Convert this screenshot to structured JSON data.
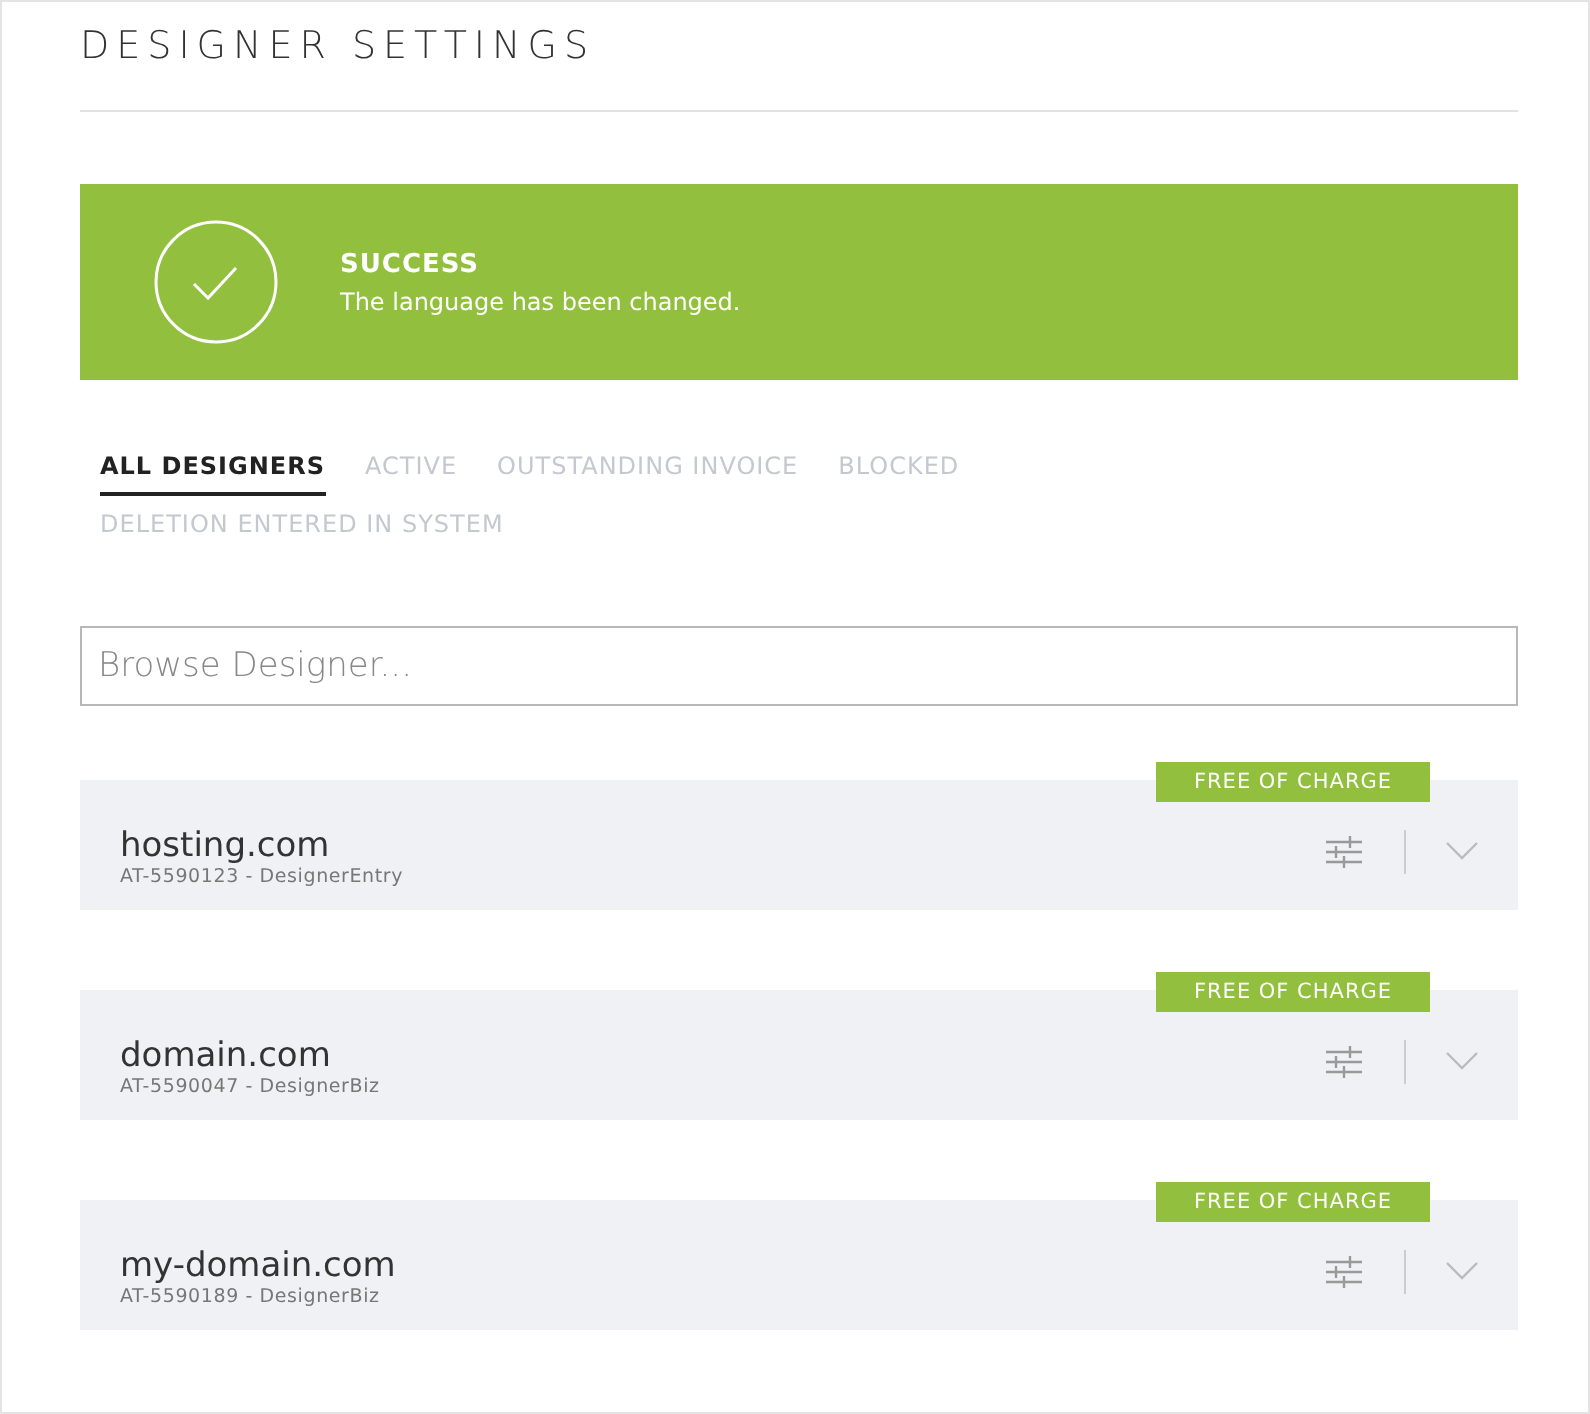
{
  "page_title": "DESIGNER SETTINGS",
  "alert": {
    "kind": "success",
    "title": "SUCCESS",
    "message": "The language has been changed."
  },
  "tabs": [
    {
      "label": "ALL DESIGNERS",
      "selected": true
    },
    {
      "label": "ACTIVE",
      "selected": false
    },
    {
      "label": "OUTSTANDING INVOICE",
      "selected": false
    },
    {
      "label": "BLOCKED",
      "selected": false
    },
    {
      "label": "DELETION ENTERED IN SYSTEM",
      "selected": false
    }
  ],
  "search": {
    "placeholder": "Browse Designer..."
  },
  "designers": [
    {
      "domain": "hosting.com",
      "detail": "AT-5590123 - DesignerEntry",
      "badge": "FREE OF CHARGE"
    },
    {
      "domain": "domain.com",
      "detail": "AT-5590047 - DesignerBiz",
      "badge": "FREE OF CHARGE"
    },
    {
      "domain": "my-domain.com",
      "detail": "AT-5590189 - DesignerBiz",
      "badge": "FREE OF CHARGE"
    }
  ]
}
